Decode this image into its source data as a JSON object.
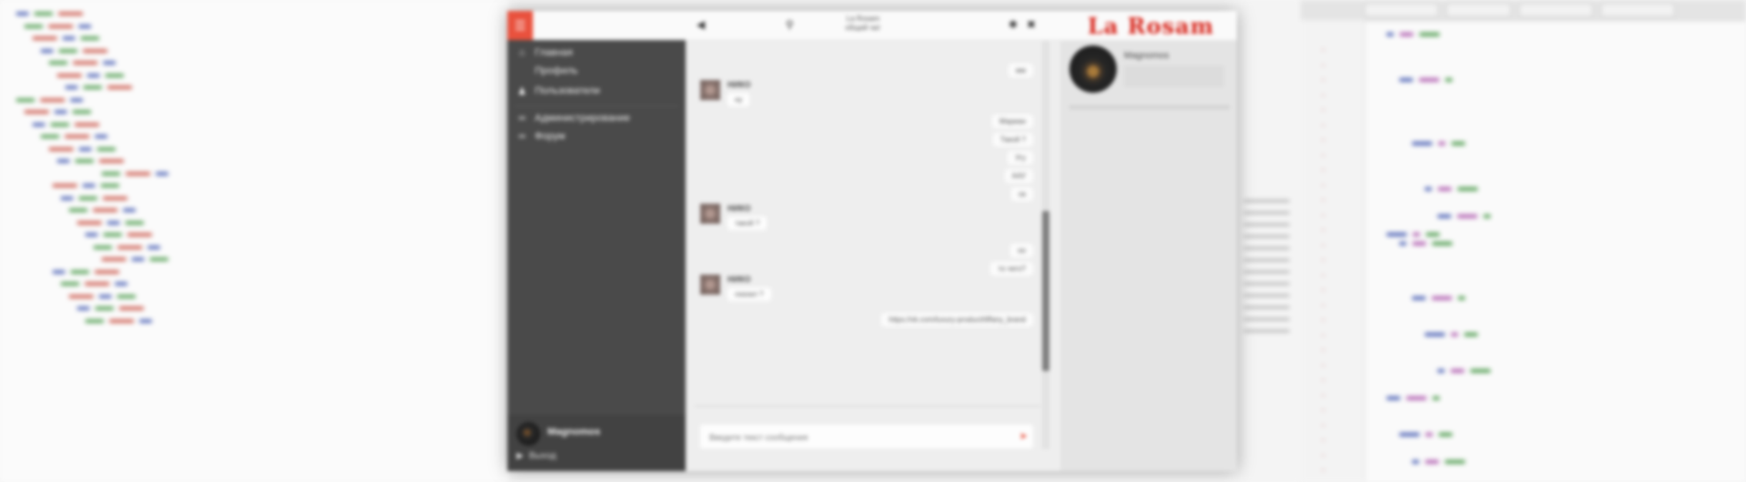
{
  "chat_window": {
    "brand": "La Rosam",
    "title_lines": [
      "La Rosam",
      "общий чат"
    ],
    "sidebar": {
      "logo_glyph": "☰",
      "items": [
        {
          "icon": "home-icon",
          "glyph": "⌂",
          "label": "Главная"
        },
        {
          "icon": "none",
          "glyph": "",
          "label": "Профиль"
        },
        {
          "icon": "users-icon",
          "glyph": "♟",
          "label": "Пользователи"
        },
        {
          "icon": "link-icon",
          "glyph": "∞",
          "label": "Администрирование"
        },
        {
          "icon": "link-icon",
          "glyph": "∞",
          "label": "Форум"
        }
      ],
      "user": {
        "name": "Magnomos",
        "status": "Выход",
        "status_glyph": "▶"
      }
    },
    "chat": {
      "top_bar": {
        "left_glyph": "◀",
        "search_glyph": "⚲",
        "settings_glyph": "✱",
        "close_glyph": "✖"
      },
      "messages": [
        {
          "dir": "in",
          "author": "НИКО",
          "text": "ну"
        },
        {
          "dir": "out",
          "text": "мм"
        },
        {
          "dir": "out",
          "text": "Мариан"
        },
        {
          "dir": "out",
          "text": "Такой ?"
        },
        {
          "dir": "out",
          "text": "Угу"
        },
        {
          "dir": "out",
          "text": "ААУ"
        },
        {
          "dir": "out",
          "text": "ок"
        },
        {
          "dir": "in",
          "author": "НИКО",
          "text": "такой ?"
        },
        {
          "dir": "out",
          "text": "оо"
        },
        {
          "dir": "out",
          "text": "то чего?"
        },
        {
          "dir": "in",
          "author": "НИКО",
          "text": "сказал ?"
        },
        {
          "dir": "out",
          "text": "https://vk.com/luxury-product/tiffany_brand"
        }
      ],
      "composer": {
        "placeholder": "Введите текст сообщения",
        "send_glyph": "➤"
      }
    },
    "right_panel": {
      "name": "Magnomos"
    }
  },
  "colors": {
    "accent": "#e9513d",
    "brand_red": "#d8261c",
    "sidebar_bg": "#4a4a4a",
    "chat_bg": "#eeeeee"
  }
}
